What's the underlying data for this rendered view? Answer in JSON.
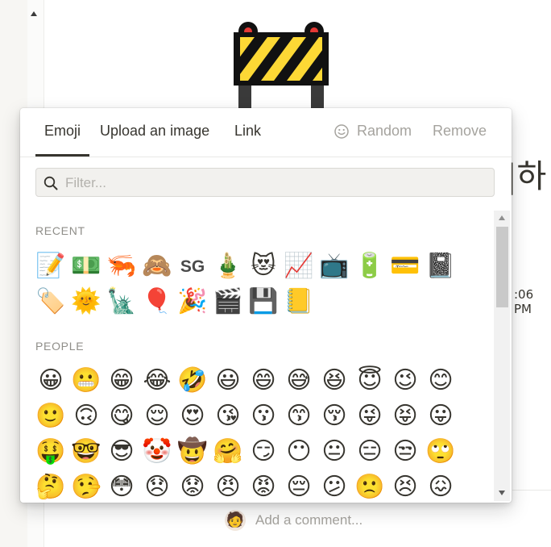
{
  "background": {
    "title_fragment": "|하",
    "time_fragment": ":06 PM",
    "comment_placeholder": "Add a comment...",
    "avatar_emoji": "🧑"
  },
  "picker": {
    "tabs": [
      {
        "label": "Emoji",
        "active": true
      },
      {
        "label": "Upload an image"
      },
      {
        "label": "Link"
      }
    ],
    "random_label": "Random",
    "remove_label": "Remove",
    "filter_placeholder": "Filter...",
    "sections": {
      "recent": {
        "label": "RECENT",
        "items": [
          "📝",
          "💵",
          "🦐",
          "🙈",
          "SG",
          "🎍",
          "😻",
          "📈",
          "📺",
          "🔋",
          "💳",
          "📓",
          "🏷️",
          "🌞",
          "🗽",
          "🎈",
          "🎉",
          "🎬",
          "💾",
          "📒"
        ]
      },
      "people": {
        "label": "PEOPLE",
        "items": [
          "😀",
          "😬",
          "😁",
          "😂",
          "🤣",
          "😃",
          "😄",
          "😅",
          "😆",
          "😇",
          "😉",
          "😊",
          "🙂",
          "🙃",
          "😋",
          "😌",
          "😍",
          "😘",
          "😗",
          "😙",
          "😚",
          "😜",
          "😝",
          "😛",
          "🤑",
          "🤓",
          "😎",
          "🤡",
          "🤠",
          "🤗",
          "😏",
          "😶",
          "😐",
          "😑",
          "😒",
          "🙄",
          "🤔",
          "🤥",
          "😳",
          "😞",
          "😟",
          "😠",
          "😡",
          "😔",
          "😕",
          "🙁",
          "😣",
          "😖"
        ]
      }
    },
    "accent_color": "#37352f",
    "muted_color": "#a5a39e"
  }
}
